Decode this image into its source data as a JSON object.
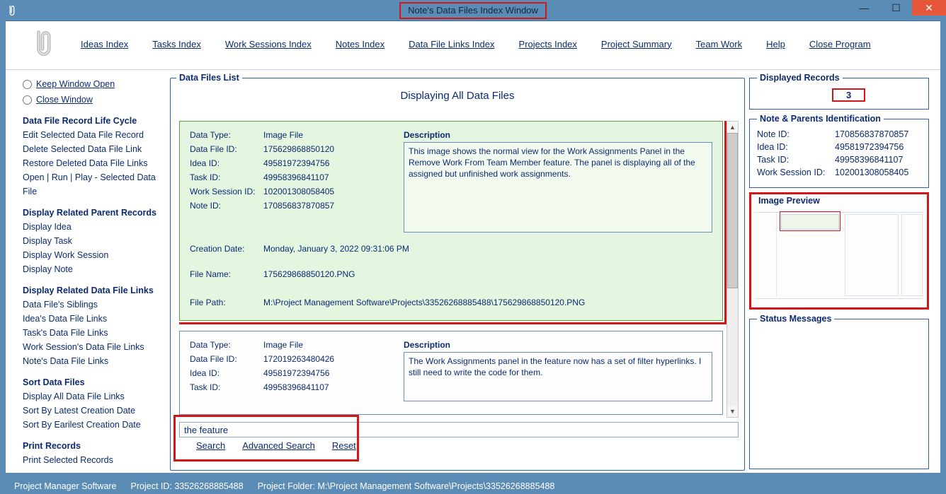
{
  "window": {
    "title": "Note's Data Files Index Window"
  },
  "toolbar": {
    "links": [
      "Ideas Index",
      "Tasks Index",
      "Work Sessions Index",
      "Notes Index",
      "Data File Links Index",
      "Projects Index",
      "Project Summary",
      "Team Work",
      "Help",
      "Close Program"
    ]
  },
  "sidebar": {
    "keep_open": "Keep Window Open",
    "close_win": "Close Window",
    "g1": "Data File Record Life Cycle",
    "g1_items": [
      "Edit Selected Data File Record",
      "Delete Selected Data File Link",
      "Restore Deleted Data File Links",
      "Open | Run | Play - Selected Data File"
    ],
    "g2": "Display Related Parent Records",
    "g2_items": [
      "Display Idea",
      "Display Task",
      "Display Work Session",
      "Display Note"
    ],
    "g3": "Display Related Data File Links",
    "g3_items": [
      "Data File's Siblings",
      "Idea's Data File Links",
      "Task's Data File Links",
      "Work Session's Data File Links",
      "Note's Data File Links"
    ],
    "g4": "Sort Data Files",
    "g4_items": [
      "Display All Data File Links",
      "Sort By Latest Creation Date",
      "Sort By Earilest Creation Date"
    ],
    "g5": "Print Records",
    "g5_items": [
      "Print Selected Records"
    ]
  },
  "center": {
    "legend": "Data Files List",
    "heading": "Displaying All Data Files",
    "labels": {
      "data_type": "Data Type:",
      "data_file_id": "Data File ID:",
      "idea_id": "Idea ID:",
      "task_id": "Task ID:",
      "ws_id": "Work Session ID:",
      "note_id": "Note ID:",
      "creation": "Creation Date:",
      "file_name": "File Name:",
      "file_path": "File Path:",
      "desc": "Description"
    },
    "records": [
      {
        "data_type": "Image File",
        "data_file_id": "175629868850120",
        "idea_id": "49581972394756",
        "task_id": "49958396841107",
        "ws_id": "102001308058405",
        "note_id": "170856837870857",
        "creation": "Monday, January 3, 2022   09:31:06 PM",
        "file_name": "175629868850120.PNG",
        "file_path": "M:\\Project Management Software\\Projects\\33526268885488\\175629868850120.PNG",
        "desc": "This image shows the normal view for the Work Assignments Panel in the Remove Work From Team Member feature. The panel is displaying all of the assigned but unfinished work assignments.",
        "selected": true
      },
      {
        "data_type": "Image File",
        "data_file_id": "172019263480426",
        "idea_id": "49581972394756",
        "task_id": "49958396841107",
        "desc": "The Work Assignments panel in the feature now has a set of filter hyperlinks. I still need to write the code for them.",
        "selected": false
      }
    ],
    "search_value": "the feature",
    "search_links": [
      "Search",
      "Advanced Search",
      "Reset"
    ]
  },
  "right": {
    "disp_legend": "Displayed Records",
    "disp_value": "3",
    "ids_legend": "Note & Parents Identification",
    "ids": {
      "Note ID:": "170856837870857",
      "Idea ID:": "49581972394756",
      "Task ID:": "49958396841107",
      "Work Session ID:": "102001308058405"
    },
    "preview_legend": "Image Preview",
    "status_legend": "Status Messages"
  },
  "statusbar": {
    "app": "Project Manager Software",
    "project_id_label": "Project ID:",
    "project_id": "33526268885488",
    "folder_label": "Project Folder:",
    "folder": "M:\\Project Management Software\\Projects\\33526268885488"
  }
}
